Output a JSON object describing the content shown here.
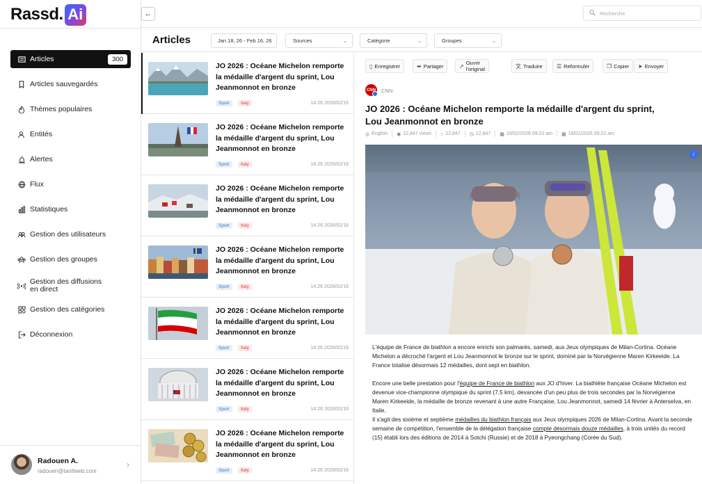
{
  "logo": {
    "text": "Rassd.",
    "badge": "Ai"
  },
  "search": {
    "placeholder": "Recherche"
  },
  "sidebar": {
    "items": [
      {
        "label": "Articles",
        "badge": "300",
        "icon": "newspaper-icon"
      },
      {
        "label": "Articles sauvegardés",
        "icon": "bookmark-icon"
      },
      {
        "label": "Thèmes populaires",
        "icon": "flame-icon"
      },
      {
        "label": "Entités",
        "icon": "entity-icon"
      },
      {
        "label": "Alertes",
        "icon": "siren-icon"
      },
      {
        "label": "Flux",
        "icon": "globe-icon"
      },
      {
        "label": "Statistiques",
        "icon": "bar-chart-icon"
      },
      {
        "label": "Gestion des utilisateurs",
        "icon": "users-icon"
      },
      {
        "label": "Gestion des groupes",
        "icon": "groups-icon"
      },
      {
        "label": "Gestion des diffusions",
        "label2": "en direct",
        "icon": "broadcast-icon"
      },
      {
        "label": "Gestion des catégories",
        "icon": "categories-icon"
      },
      {
        "label": "Déconnexion",
        "icon": "logout-icon"
      }
    ]
  },
  "user": {
    "name": "Radouen A.",
    "email": "radouen@tanitweb.com"
  },
  "header": {
    "title": "Articles"
  },
  "filters": {
    "date": "Jan 18, 26 - Feb 16, 26",
    "sources": "Sources",
    "category": "Catégorie",
    "groups": "Groupes"
  },
  "articles": [
    {
      "title": "JO 2026 : Océane Michelon remporte la médaille d'argent du sprint, Lou Jeanmonnot en bronze",
      "tag1": "Sport",
      "tag2": "Italy",
      "time": "14:26 2026/02/16"
    },
    {
      "title": "JO 2026 : Océane Michelon remporte la médaille d'argent du sprint, Lou Jeanmonnot en bronze",
      "tag1": "Sport",
      "tag2": "Italy",
      "time": "14:26 2026/02/16"
    },
    {
      "title": "JO 2026 : Océane Michelon remporte la médaille d'argent du sprint, Lou Jeanmonnot en bronze",
      "tag1": "Sport",
      "tag2": "Italy",
      "time": "14:26 2026/02/16"
    },
    {
      "title": "JO 2026 : Océane Michelon remporte la médaille d'argent du sprint, Lou Jeanmonnot en bronze",
      "tag1": "Sport",
      "tag2": "Italy",
      "time": "14:26 2026/02/16"
    },
    {
      "title": "JO 2026 : Océane Michelon remporte la médaille d'argent du sprint, Lou Jeanmonnot en bronze",
      "tag1": "Sport",
      "tag2": "Italy",
      "time": "14:26 2026/02/16"
    },
    {
      "title": "JO 2026 : Océane Michelon remporte la médaille d'argent du sprint, Lou Jeanmonnot en bronze",
      "tag1": "Sport",
      "tag2": "Italy",
      "time": "14:26 2026/02/16"
    },
    {
      "title": "JO 2026 : Océane Michelon remporte la médaille d'argent du sprint, Lou Jeanmonnot en bronze",
      "tag1": "Sport",
      "tag2": "Italy",
      "time": "14:26 2026/02/16"
    }
  ],
  "actions": [
    "Enregistrer",
    "Partager",
    "Ouvrir l'original",
    "Traduire",
    "Reformuler",
    "Copier",
    "Envoyer"
  ],
  "detail": {
    "source": "CNN",
    "source_logo": "CNN",
    "title": "JO 2026 : Océane Michelon remporte la médaille d'argent du sprint, Lou Jeanmonnot en bronze",
    "language": "English",
    "views": "12,847 views",
    "likes": "12,847",
    "reads": "12,847",
    "date1": "18/02/2026 09:22 am",
    "date2": "18/02/2026 09:22 am",
    "p1": "L'équipe de France de biathlon a encore enrichi son palmarès, samedi, aux Jeux olympiques de Milan-Cortina. Océane Michelon a décroché l'argent et Lou Jeanmonnot le bronze sur le sprint, dominé par la Norvégienne Maren Kirkeeide. La France totalise désormais 12 médailles, dont sept en biathlon.",
    "p2a": "Encore une belle prestation pour l'",
    "p2link": "équipe de France de biathlon",
    "p2b": " aux JO d'hiver. La biathlète française Océane Michelon est devenue vice-championne olympique du sprint (7,5 km), devancée d'un peu plus de trois secondes par la Norvégienne Maren Kirkeeide, la médaille de bronze revenant à une autre Française, Lou Jeanmonnot, samedi 14 février à Anterselva, en Italie.",
    "p3a": "Il s'agit des sixième et septième ",
    "p3link1": "médailles du biathlon français",
    "p3b": " aux Jeux olympiques 2026 de Milan-Cortina. Avant la seconde semaine de compétition, l'ensemble de la délégation française ",
    "p3link2": "compte désormais douze médailles",
    "p3c": ", à trois unités du record (15) établi lors des éditions de 2014 à Sotchi (Russie) et de 2018 à Pyeongchang (Corée du Sud)."
  },
  "colors": {
    "accent": "#111111",
    "sport_tag": "#3a73c8",
    "italy_tag": "#d24a4a"
  }
}
